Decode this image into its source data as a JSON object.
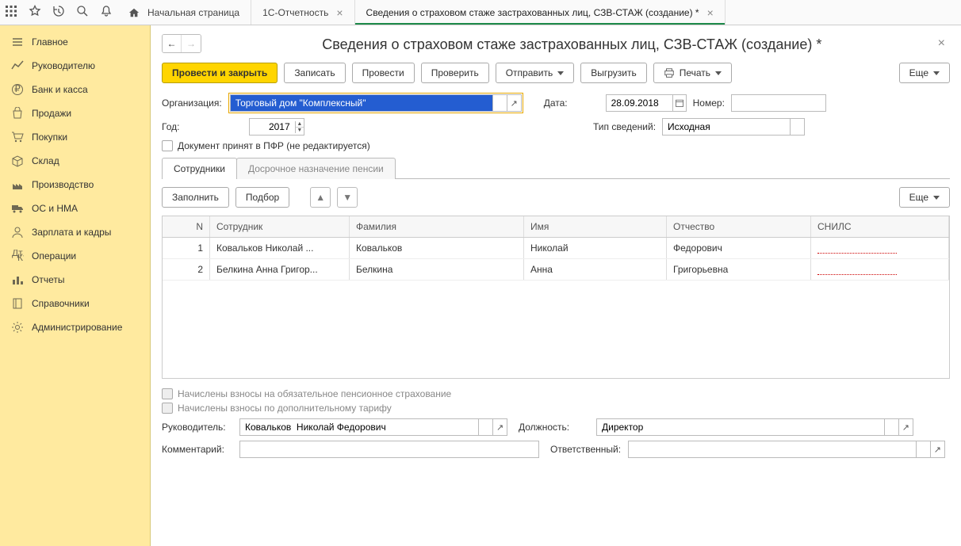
{
  "topbar": {
    "tabs": {
      "home": "Начальная страница",
      "reporting": "1С-Отчетность",
      "current": "Сведения о страховом стаже застрахованных лиц, СЗВ-СТАЖ (создание) *"
    }
  },
  "sidebar": {
    "items": [
      {
        "label": "Главное"
      },
      {
        "label": "Руководителю"
      },
      {
        "label": "Банк и касса"
      },
      {
        "label": "Продажи"
      },
      {
        "label": "Покупки"
      },
      {
        "label": "Склад"
      },
      {
        "label": "Производство"
      },
      {
        "label": "ОС и НМА"
      },
      {
        "label": "Зарплата и кадры"
      },
      {
        "label": "Операции"
      },
      {
        "label": "Отчеты"
      },
      {
        "label": "Справочники"
      },
      {
        "label": "Администрирование"
      }
    ]
  },
  "page": {
    "title": "Сведения о страховом стаже застрахованных лиц, СЗВ-СТАЖ (создание) *"
  },
  "toolbar": {
    "post_close": "Провести и закрыть",
    "write": "Записать",
    "post": "Провести",
    "check": "Проверить",
    "send": "Отправить",
    "upload": "Выгрузить",
    "print": "Печать",
    "more": "Еще"
  },
  "labels": {
    "org": "Организация:",
    "date": "Дата:",
    "number": "Номер:",
    "year": "Год:",
    "type": "Тип сведений:",
    "pfr_checkbox": "Документ принят в ПФР (не редактируется)",
    "fill": "Заполнить",
    "select": "Подбор",
    "sub_more": "Еще",
    "pension_contrib": "Начислены взносы на обязательное пенсионное страхование",
    "extra_tariff": "Начислены взносы по дополнительному тарифу",
    "head": "Руководитель:",
    "position": "Должность:",
    "comment": "Комментарий:",
    "responsible": "Ответственный:"
  },
  "values": {
    "org": "Торговый дом \"Комплексный\"",
    "date": "28.09.2018",
    "number": "",
    "year": "2017",
    "type": "Исходная",
    "head": "Ковальков  Николай Федорович",
    "position": "Директор",
    "comment": "",
    "responsible": ""
  },
  "subtabs": {
    "employees": "Сотрудники",
    "pension": "Досрочное назначение пенсии"
  },
  "table": {
    "cols": {
      "n": "N",
      "employee": "Сотрудник",
      "surname": "Фамилия",
      "name": "Имя",
      "patronymic": "Отчество",
      "snils": "СНИЛС"
    },
    "rows": [
      {
        "n": "1",
        "emp": "Ковальков  Николай ...",
        "fam": "Ковальков",
        "name": "Николай",
        "pat": "Федорович",
        "snils": ""
      },
      {
        "n": "2",
        "emp": "Белкина Анна  Григор...",
        "fam": "Белкина",
        "name": "Анна",
        "pat": "Григорьевна",
        "snils": ""
      }
    ]
  }
}
